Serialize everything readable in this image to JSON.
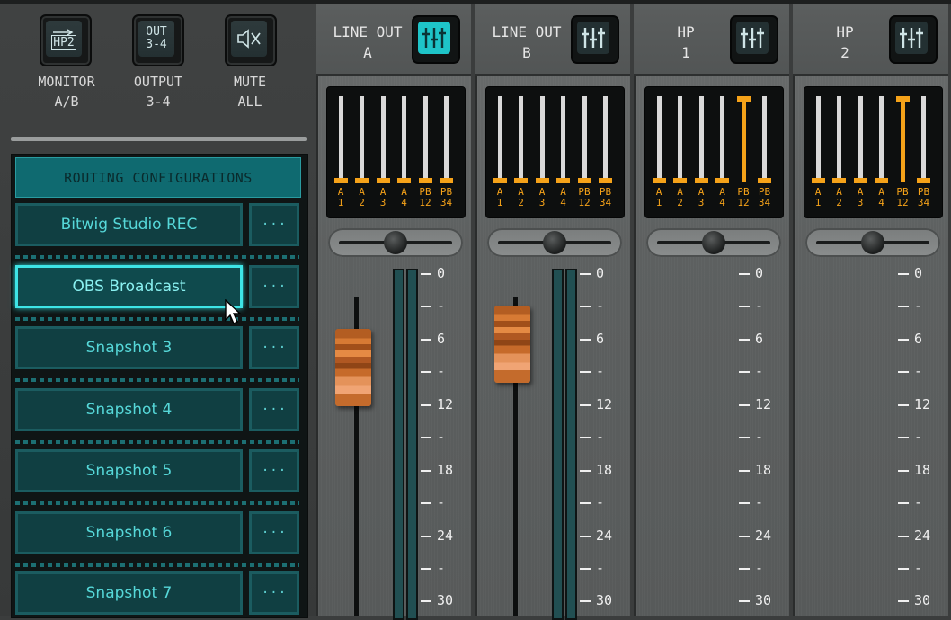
{
  "monitor_controls": [
    {
      "icon_text": "HP2",
      "label_line1": "MONITOR",
      "label_line2": "A/B"
    },
    {
      "icon_text": "OUT 3-4",
      "label_line1": "OUTPUT",
      "label_line2": "3-4"
    },
    {
      "icon_text": "",
      "label_line1": "MUTE",
      "label_line2": "ALL"
    }
  ],
  "routing": {
    "header": "ROUTING CONFIGURATIONS",
    "more_label": "···",
    "items": [
      {
        "label": "Bitwig Studio REC",
        "selected": false
      },
      {
        "label": "OBS Broadcast",
        "selected": true
      },
      {
        "label": "Snapshot 3",
        "selected": false
      },
      {
        "label": "Snapshot 4",
        "selected": false
      },
      {
        "label": "Snapshot 5",
        "selected": false
      },
      {
        "label": "Snapshot 6",
        "selected": false
      },
      {
        "label": "Snapshot 7",
        "selected": false
      }
    ]
  },
  "meter_labels": [
    {
      "top": "A",
      "bottom": "1"
    },
    {
      "top": "A",
      "bottom": "2"
    },
    {
      "top": "A",
      "bottom": "3"
    },
    {
      "top": "A",
      "bottom": "4"
    },
    {
      "top": "PB",
      "bottom": "12"
    },
    {
      "top": "PB",
      "bottom": "34"
    }
  ],
  "scale_marks": [
    "0",
    "-",
    "6",
    "-",
    "12",
    "-",
    "18",
    "-",
    "24",
    "-",
    "30"
  ],
  "channels": [
    {
      "title_line1": "LINE OUT",
      "title_line2": "A",
      "mix_active": true,
      "pb12_raised": false,
      "has_fader": true
    },
    {
      "title_line1": "LINE OUT",
      "title_line2": "B",
      "mix_active": false,
      "pb12_raised": false,
      "has_fader": true
    },
    {
      "title_line1": "HP",
      "title_line2": "1",
      "mix_active": false,
      "pb12_raised": true,
      "has_fader": false
    },
    {
      "title_line1": "HP",
      "title_line2": "2",
      "mix_active": false,
      "pb12_raised": true,
      "has_fader": false
    }
  ],
  "colors": {
    "accent_teal": "#1ec4c8",
    "meter_orange": "#f5a219",
    "fader_orange": "#d77a34"
  }
}
